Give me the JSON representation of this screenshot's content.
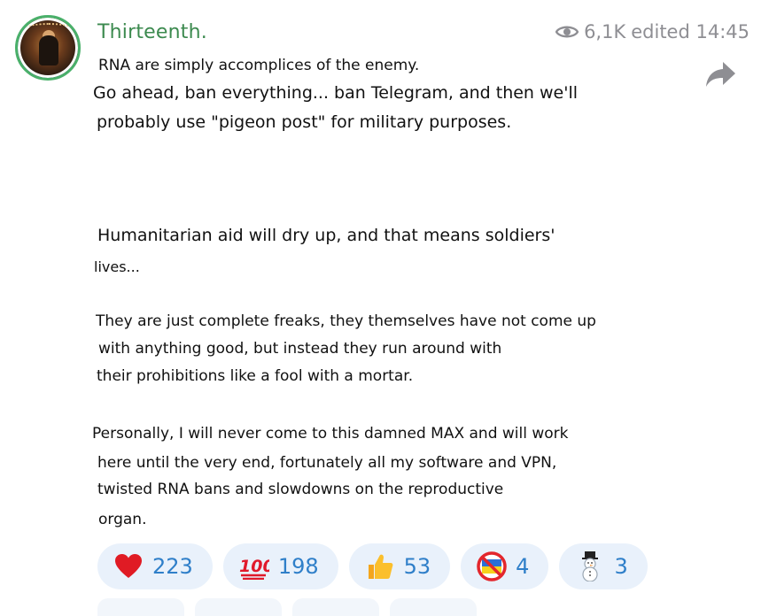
{
  "header": {
    "channel_name": "Thirteenth.",
    "views": "6,1K",
    "edited": "edited 14:45"
  },
  "message": {
    "lines": [
      "RNA are simply accomplices of the enemy.",
      "Go ahead, ban everything... ban Telegram, and then we'll",
      "probably use \"pigeon post\" for military purposes.",
      "Humanitarian aid will dry up, and that means soldiers'",
      "lives...",
      "They are just complete freaks, they themselves have not come up",
      "with anything good, but instead they run around with",
      "their prohibitions like a fool with a mortar.",
      "Personally, I will never come to this damned MAX and will work",
      "here until the very end, fortunately all my software and VPN,",
      "twisted RNA bans and slowdowns on the reproductive",
      "organ."
    ]
  },
  "reactions": [
    {
      "icon": "heart-icon",
      "count": "223"
    },
    {
      "icon": "hundred-icon",
      "count": "198"
    },
    {
      "icon": "thumbs-up-icon",
      "count": "53"
    },
    {
      "icon": "no-flag-icon",
      "count": "4"
    },
    {
      "icon": "snowman-icon",
      "count": "3"
    }
  ],
  "colors": {
    "accent_green": "#3c8a4f",
    "reaction_bg": "#e9f1fb",
    "reaction_text": "#2f7fc9",
    "meta_gray": "#8e8e93"
  }
}
